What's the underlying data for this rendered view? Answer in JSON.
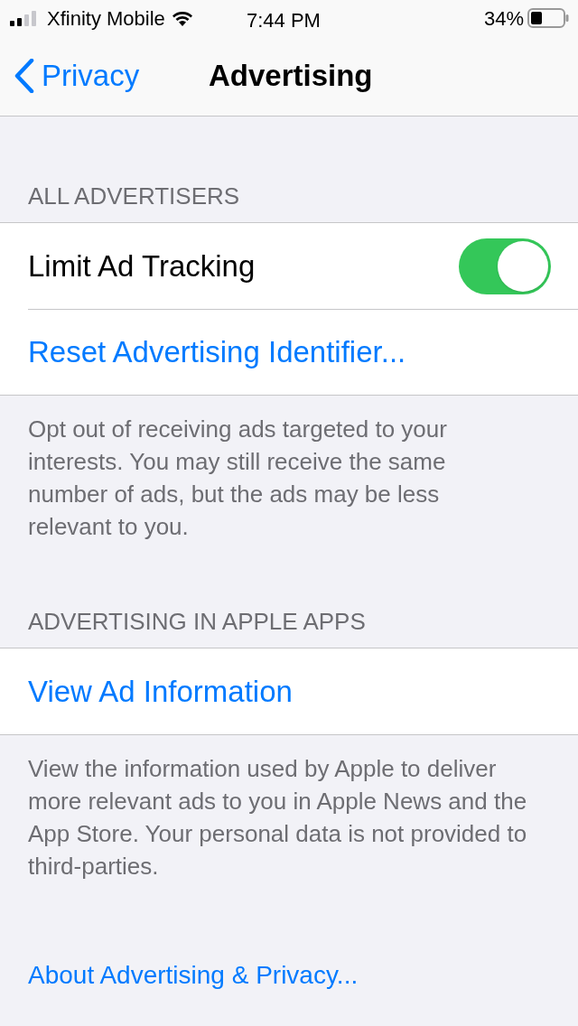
{
  "status_bar": {
    "carrier": "Xfinity Mobile",
    "time": "7:44 PM",
    "battery": "34%"
  },
  "nav": {
    "back": "Privacy",
    "title": "Advertising"
  },
  "sections": [
    {
      "header": "ALL ADVERTISERS",
      "rows": [
        {
          "kind": "toggle",
          "label": "Limit Ad Tracking",
          "on": true
        },
        {
          "kind": "link",
          "label": "Reset Advertising Identifier..."
        }
      ],
      "footer": "Opt out of receiving ads targeted to your interests. You may still receive the same number of ads, but the ads may be less relevant to you."
    },
    {
      "header": "ADVERTISING IN APPLE APPS",
      "rows": [
        {
          "kind": "link",
          "label": "View Ad Information"
        }
      ],
      "footer": "View the information used by Apple to deliver more relevant ads to you in Apple News and the App Store. Your personal data is not provided to third-parties."
    }
  ],
  "bottom_link": "About Advertising & Privacy..."
}
